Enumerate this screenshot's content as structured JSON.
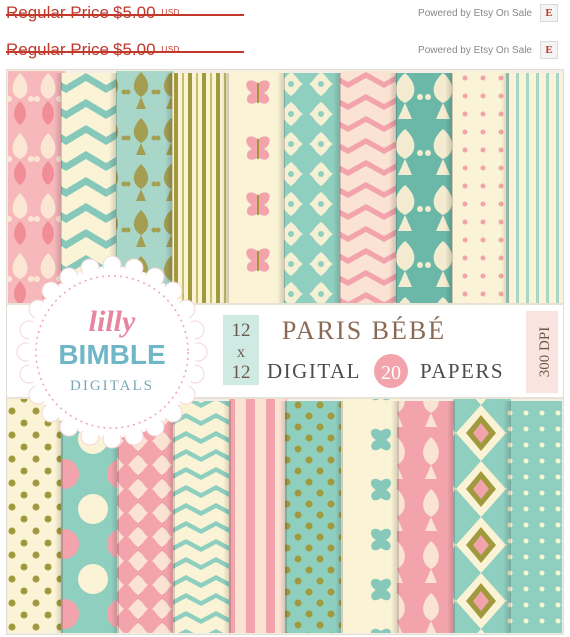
{
  "listing": {
    "rows": [
      {
        "label": "Regular Price",
        "amount": "$5.00",
        "currency": "USD",
        "powered_by": "Powered by Etsy On Sale",
        "badge": "E"
      },
      {
        "label": "Regular Price",
        "amount": "$5.00",
        "currency": "USD",
        "powered_by": "Powered by Etsy On Sale",
        "badge": "E"
      }
    ]
  },
  "product": {
    "logo": {
      "line1": "lilly",
      "line2": "BIMBLE",
      "line3": "DIGITALS"
    },
    "size": {
      "w": "12",
      "x": "x",
      "h": "12"
    },
    "title": "PARIS BÉBÉ",
    "digital": "DIGITAL",
    "count": "20",
    "papers": "PAPERS",
    "dpi": "300 DPI"
  },
  "colors": {
    "price_red": "#c0392b",
    "pink": "#f2a3ac",
    "mint": "#8fcfc0",
    "cream": "#fbf3d5",
    "olive": "#a19a3d",
    "title_text": "#8a6a55"
  }
}
